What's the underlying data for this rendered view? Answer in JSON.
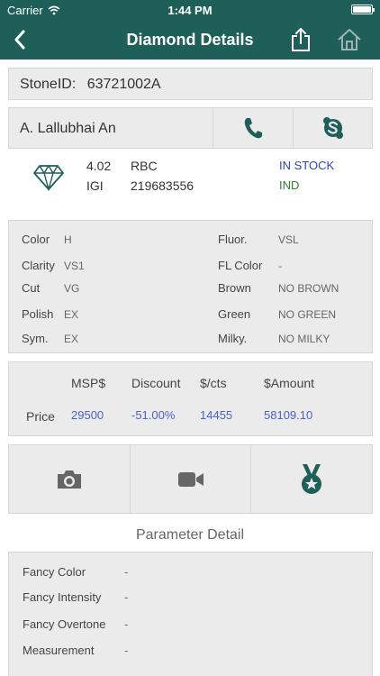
{
  "status_bar": {
    "carrier": "Carrier",
    "time": "1:44 PM"
  },
  "nav": {
    "title": "Diamond Details",
    "back_icon": "chevron-left-icon",
    "share_icon": "share-icon",
    "home_icon": "home-icon"
  },
  "stone": {
    "label": "StoneID:",
    "value": "63721002A"
  },
  "supplier": {
    "name": "A. Lallubhai An",
    "call_icon": "phone-icon",
    "skype_icon": "skype-icon"
  },
  "summary": {
    "carat": "4.02",
    "shape": "RBC",
    "lab": "IGI",
    "cert_no": "219683556",
    "stock_status": "IN STOCK",
    "location": "IND"
  },
  "specs": {
    "color_label": "Color",
    "color": "H",
    "clarity_label": "Clarity",
    "clarity": "VS1",
    "cut_label": "Cut",
    "cut": "VG",
    "polish_label": "Polish",
    "polish": "EX",
    "sym_label": "Sym.",
    "sym": "EX",
    "fluor_label": "Fluor.",
    "fluor": "VSL",
    "fl_color_label": "FL Color",
    "fl_color": "-",
    "brown_label": "Brown",
    "brown": "NO BROWN",
    "green_label": "Green",
    "green": "NO GREEN",
    "milky_label": "Milky.",
    "milky": "NO MILKY"
  },
  "price": {
    "row_label": "Price",
    "headers": [
      "MSP$",
      "Discount",
      "$/cts",
      "$Amount"
    ],
    "values": [
      "29500",
      "-51.00%",
      "14455",
      "58109.10"
    ]
  },
  "media": {
    "photo_icon": "camera-icon",
    "video_icon": "video-camera-icon",
    "cert_icon": "award-medal-icon"
  },
  "parameter_detail": {
    "title": "Parameter Detail",
    "rows": [
      {
        "label": "Fancy Color",
        "value": "-"
      },
      {
        "label": "Fancy Intensity",
        "value": "-"
      },
      {
        "label": "Fancy Overtone",
        "value": "-"
      },
      {
        "label": "Measurement",
        "value": "-"
      }
    ]
  },
  "colors": {
    "brand": "#1f5f59",
    "link_blue": "#4a62c4",
    "in_stock": "#3046a8",
    "location": "#2e7d32",
    "panel": "#ebebeb"
  }
}
